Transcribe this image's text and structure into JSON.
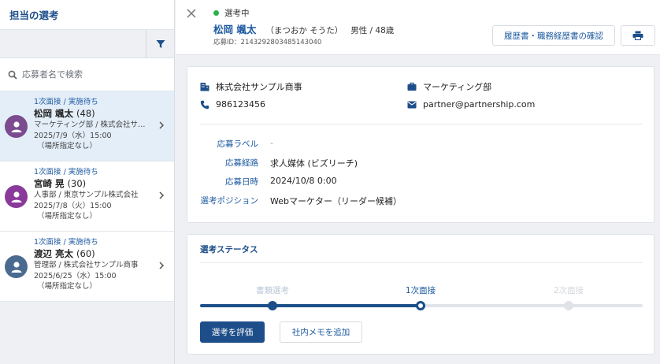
{
  "sidebar": {
    "title": "担当の選考",
    "search_placeholder": "応募者名で検索",
    "items": [
      {
        "stage": "1次面接 / 実施待ち",
        "name": "松岡 颯太",
        "age": "(48)",
        "dept": "マーケティング部 / 株式会社サ…",
        "date": "2025/7/9（水）15:00",
        "place": "（場所指定なし）",
        "avatar_color": "#7b4a8f"
      },
      {
        "stage": "1次面接 / 実施待ち",
        "name": "宮崎 晃",
        "age": "(30)",
        "dept": "人事部 / 東京サンプル株式会社",
        "date": "2025/7/8（火）15:00",
        "place": "（場所指定なし）",
        "avatar_color": "#8a3a9a"
      },
      {
        "stage": "1次面接 / 実施待ち",
        "name": "渡辺 亮太",
        "age": "(60)",
        "dept": "管理部 / 株式会社サンプル商事",
        "date": "2025/6/25（水）15:00",
        "place": "（場所指定なし）",
        "avatar_color": "#4b6a8f"
      }
    ]
  },
  "header": {
    "status": "選考中",
    "status_color": "#2bb34a",
    "name": "松岡 颯太",
    "kana": "（まつおか そうた）",
    "meta": "男性 / 48歳",
    "app_id": "応募ID：2143292803485143040",
    "resume_button": "履歴書・職務経歴書の確認"
  },
  "info": {
    "company": "株式会社サンプル商事",
    "department": "マーケティング部",
    "phone": "986123456",
    "email": "partner@partnership.com",
    "fields": [
      {
        "label": "応募ラベル",
        "value": "-"
      },
      {
        "label": "応募経路",
        "value": "求人媒体 (ビズリーチ)"
      },
      {
        "label": "応募日時",
        "value": "2024/10/8 0:00"
      },
      {
        "label": "選考ポジション",
        "value": "Webマーケター（リーダー候補）"
      }
    ]
  },
  "status_card": {
    "title": "選考ステータス",
    "steps": [
      {
        "label": "書類選考",
        "state": "done"
      },
      {
        "label": "1次面接",
        "state": "current"
      },
      {
        "label": "2次面接",
        "state": "todo"
      }
    ],
    "evaluate_button": "選考を評価",
    "memo_button": "社内メモを追加"
  },
  "colors": {
    "accent": "#1d4e89",
    "link": "#1d5aa0",
    "active_row": "#e3eef9"
  }
}
